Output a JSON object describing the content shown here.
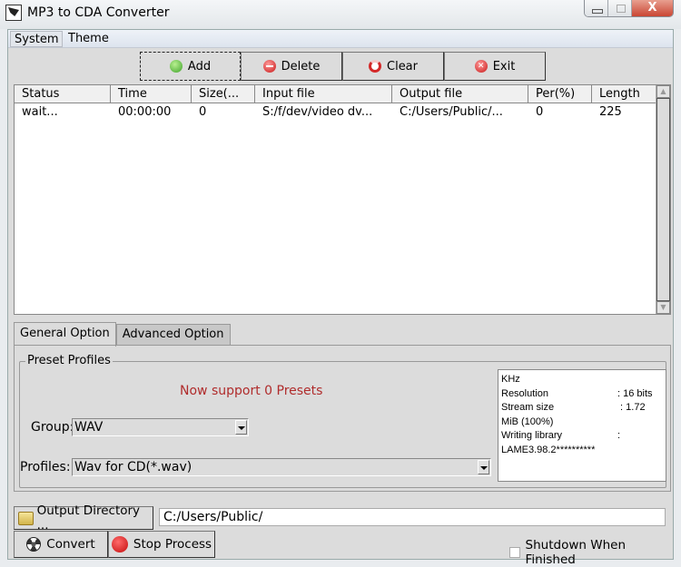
{
  "window": {
    "title": "MP3 to CDA Converter",
    "controls": {
      "minimize": "minimize",
      "maximize": "maximize",
      "close": "X"
    }
  },
  "menu": [
    {
      "label": "System"
    },
    {
      "label": "Theme"
    }
  ],
  "toolbar": {
    "add": "Add",
    "delete": "Delete",
    "clear": "Clear",
    "exit": "Exit"
  },
  "file_list": {
    "columns": [
      "Status",
      "Time",
      "Size(...",
      "Input file",
      "Output file",
      "Per(%)",
      "Length"
    ],
    "rows": [
      {
        "status": "wait...",
        "time": "00:00:00",
        "size": "0",
        "input": "S:/f/dev/video dv...",
        "output": "C:/Users/Public/...",
        "per": "0",
        "length": "225"
      }
    ]
  },
  "tabs": [
    {
      "label": "General Option",
      "active": true
    },
    {
      "label": "Advanced Option",
      "active": false
    }
  ],
  "preset": {
    "group_title": "Preset Profiles",
    "support_text": "Now support 0 Presets",
    "group_label": "Group:",
    "group_value": "WAV",
    "profiles_label": "Profiles:",
    "profiles_value": "Wav for CD(*.wav)"
  },
  "info": [
    {
      "key": "KHz",
      "value": ""
    },
    {
      "key": "Resolution",
      "value": ": 16 bits"
    },
    {
      "key": "Stream size",
      "value": " : 1.72"
    },
    {
      "key": "MiB (100%)",
      "value": ""
    },
    {
      "key": "Writing library",
      "value": ":"
    },
    {
      "key": "LAME3.98.2**********",
      "value": ""
    }
  ],
  "output": {
    "button_label": "Output Directory ...",
    "path": "C:/Users/Public/"
  },
  "actions": {
    "convert": "Convert",
    "stop": "Stop Process",
    "shutdown_label": "Shutdown When Finished",
    "shutdown_checked": false
  }
}
